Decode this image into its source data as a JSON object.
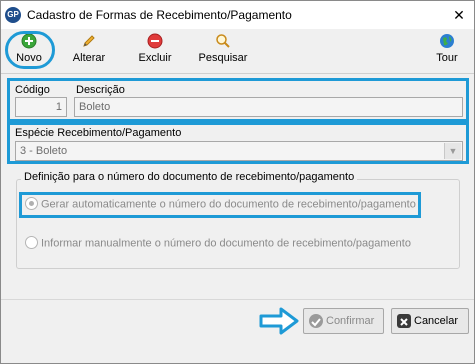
{
  "window": {
    "title": "Cadastro de Formas de Recebimento/Pagamento",
    "close_glyph": "✕",
    "app_icon_text": "GP"
  },
  "toolbar": {
    "novo": "Novo",
    "alterar": "Alterar",
    "excluir": "Excluir",
    "pesquisar": "Pesquisar",
    "tour": "Tour"
  },
  "form": {
    "codigo_label": "Código",
    "codigo_value": "1",
    "descricao_label": "Descrição",
    "descricao_value": "Boleto",
    "especie_label": "Espécie Recebimento/Pagamento",
    "especie_value": "3  -  Boleto"
  },
  "group": {
    "legend": "Definição para o número do documento de recebimento/pagamento",
    "option_auto": "Gerar automaticamente o número do documento de recebimento/pagamento",
    "option_manual": "Informar manualmente o número do documento de recebimento/pagamento",
    "selected": "auto"
  },
  "buttons": {
    "confirmar": "Confirmar",
    "cancelar": "Cancelar"
  },
  "colors": {
    "highlight": "#1e9ad6"
  }
}
